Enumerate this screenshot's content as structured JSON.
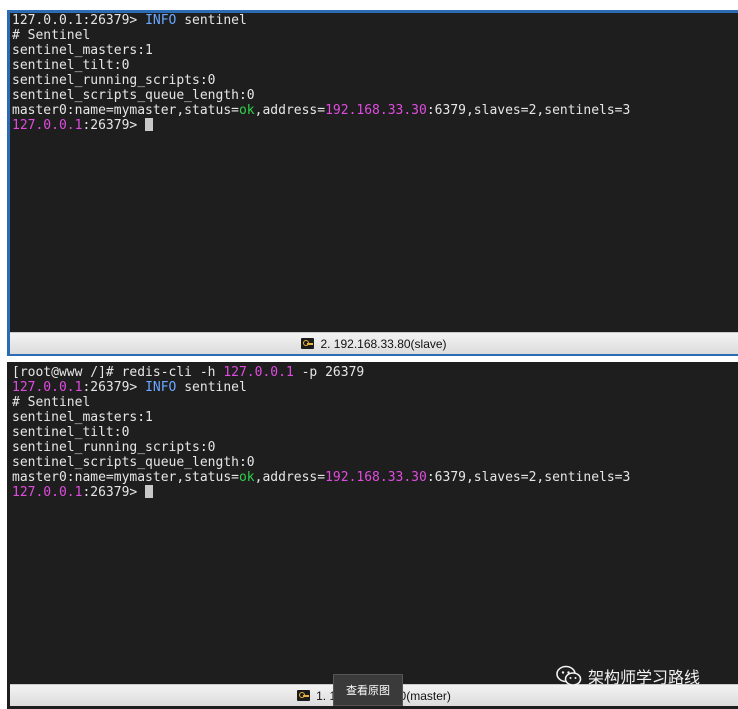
{
  "top_pane": {
    "lines": [
      [
        {
          "t": "127.0.0.1:26379> ",
          "c": ""
        },
        {
          "t": "INFO",
          "c": "c-cyan"
        },
        {
          "t": " sentinel",
          "c": ""
        }
      ],
      [
        {
          "t": "# Sentinel",
          "c": ""
        }
      ],
      [
        {
          "t": "sentinel_masters:1",
          "c": ""
        }
      ],
      [
        {
          "t": "sentinel_tilt:0",
          "c": ""
        }
      ],
      [
        {
          "t": "sentinel_running_scripts:0",
          "c": ""
        }
      ],
      [
        {
          "t": "sentinel_scripts_queue_length:0",
          "c": ""
        }
      ],
      [
        {
          "t": "master0:name=mymaster,status=",
          "c": ""
        },
        {
          "t": "ok",
          "c": "c-green"
        },
        {
          "t": ",address=",
          "c": ""
        },
        {
          "t": "192.168.33.30",
          "c": "c-pink"
        },
        {
          "t": ":6379,slaves=2,sentinels=3",
          "c": ""
        }
      ],
      [
        {
          "t": "127.0.0.1",
          "c": "c-pink"
        },
        {
          "t": ":26379> ",
          "c": ""
        }
      ]
    ],
    "status_label": "2. 192.168.33.80(slave)"
  },
  "bottom_pane": {
    "lines": [
      [
        {
          "t": "[root@www /]# redis-cli -h ",
          "c": ""
        },
        {
          "t": "127.0.0.1",
          "c": "c-pink"
        },
        {
          "t": " -p 26379",
          "c": ""
        }
      ],
      [
        {
          "t": "127.0.0.1",
          "c": "c-pink"
        },
        {
          "t": ":26379> ",
          "c": ""
        },
        {
          "t": "INFO",
          "c": "c-cyan"
        },
        {
          "t": " sentinel",
          "c": ""
        }
      ],
      [
        {
          "t": "# Sentinel",
          "c": ""
        }
      ],
      [
        {
          "t": "sentinel_masters:1",
          "c": ""
        }
      ],
      [
        {
          "t": "sentinel_tilt:0",
          "c": ""
        }
      ],
      [
        {
          "t": "sentinel_running_scripts:0",
          "c": ""
        }
      ],
      [
        {
          "t": "sentinel_scripts_queue_length:0",
          "c": ""
        }
      ],
      [
        {
          "t": "master0:name=mymaster,status=",
          "c": ""
        },
        {
          "t": "ok",
          "c": "c-green"
        },
        {
          "t": ",address=",
          "c": ""
        },
        {
          "t": "192.168.33.30",
          "c": "c-pink"
        },
        {
          "t": ":6379,slaves=2,sentinels=3",
          "c": ""
        }
      ],
      [
        {
          "t": "127.0.0.1",
          "c": "c-pink"
        },
        {
          "t": ":26379> ",
          "c": ""
        }
      ]
    ],
    "status_label": "1. 192.168.33.30(master)"
  },
  "overlay": {
    "tooltip_label": "查看原图",
    "watermark_text": "架构师学习路线",
    "watermark_icon": "wechat-icon"
  },
  "colors": {
    "terminal_bg": "#1e1e1e",
    "terminal_fg": "#e6e6e6",
    "ip_highlight": "#e04ce0",
    "keyword_highlight": "#6aa8ff",
    "ok_highlight": "#2fd04a",
    "frame_accent": "#2b6cb5"
  },
  "icons": {
    "status_key": "key-icon",
    "cursor": "terminal-cursor"
  }
}
